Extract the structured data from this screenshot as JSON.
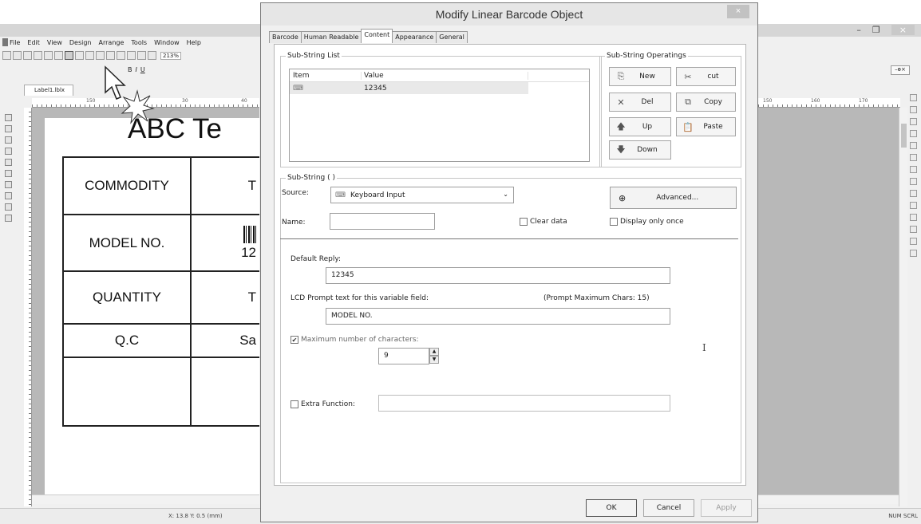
{
  "app": {
    "menu": [
      "File",
      "Edit",
      "View",
      "Design",
      "Arrange",
      "Tools",
      "Window",
      "Help"
    ],
    "zoom": "213%",
    "doc_tab": "Label1.lblx",
    "ruler_left": [
      "150",
      "30",
      "40"
    ],
    "ruler_right": [
      "150",
      "160",
      "170"
    ],
    "status_xy": "X: 13.8 Y: 0.5 (mm)",
    "status_keys": "NUM SCRL"
  },
  "label": {
    "title": "ABC Te",
    "rows": [
      {
        "name": "COMMODITY",
        "value": "T"
      },
      {
        "name": "MODEL NO.",
        "value": "12"
      },
      {
        "name": "QUANTITY",
        "value": "T"
      },
      {
        "name": "Q.C",
        "value": "Sa"
      },
      {
        "name": "",
        "value": ""
      }
    ]
  },
  "dialog": {
    "title": "Modify Linear Barcode Object",
    "close": "×",
    "tabs": [
      "Barcode",
      "Human Readable",
      "Content",
      "Appearance",
      "General"
    ],
    "active_tab": "Content",
    "substring_list": {
      "title": "Sub-String List",
      "col_item": "Item",
      "col_value": "Value",
      "rows": [
        {
          "item_icon": "keyboard-icon",
          "value": "12345"
        }
      ]
    },
    "ops": {
      "title": "Sub-String Operatings",
      "new": "New",
      "cut": "cut",
      "del": "Del",
      "copy": "Copy",
      "up": "Up",
      "paste": "Paste",
      "down": "Down"
    },
    "substring": {
      "title": "Sub-String (      )",
      "source_label": "Source:",
      "source_value": "Keyboard Input",
      "advanced": "Advanced...",
      "name_label": "Name:",
      "name_value": "",
      "clear_data": "Clear data",
      "display_once": "Display only once",
      "default_reply_label": "Default Reply:",
      "default_reply": "12345",
      "lcd_label": "LCD Prompt text for this variable field:",
      "lcd_max": "(Prompt Maximum Chars: 15)",
      "lcd_value": "MODEL NO.",
      "max_chars_label": "Maximum number of characters:",
      "max_chars_checked": true,
      "max_chars": "9",
      "extra_label": "Extra Function:",
      "extra_value": ""
    },
    "footer": {
      "ok": "OK",
      "cancel": "Cancel",
      "apply": "Apply"
    }
  }
}
